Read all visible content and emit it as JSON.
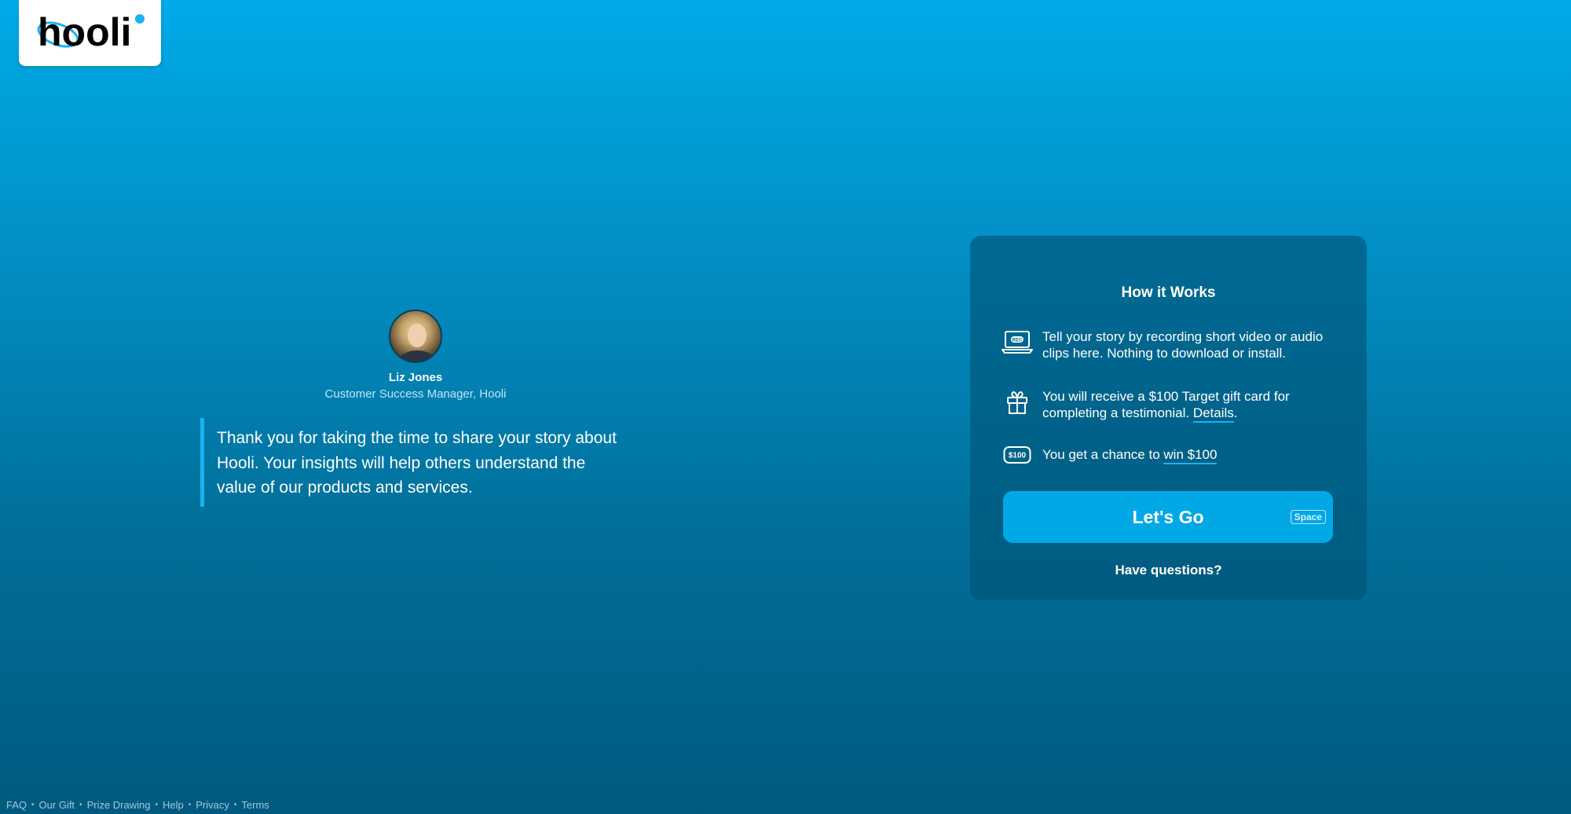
{
  "logo": {
    "text": "hooli"
  },
  "profile": {
    "name": "Liz Jones",
    "role": "Customer Success Manager, Hooli"
  },
  "quote": {
    "text": "Thank you for taking the time to share your story about Hooli. Your insights will help others understand the value of our products and services."
  },
  "how_it_works": {
    "title": "How it Works",
    "step1": {
      "icon": "laptop-rec-icon",
      "text": "Tell your story by recording short video or audio clips here. Nothing to download or install."
    },
    "step2": {
      "icon": "gift-icon",
      "text_before": "You will receive a $100 Target gift card for completing a testimonial. ",
      "link": "Details",
      "text_after": "."
    },
    "step3": {
      "icon": "prize-100-icon",
      "badge": "$100",
      "text_before": "You get a chance to ",
      "link": "win $100"
    },
    "rec_label": "REC",
    "button_label": "Let's Go",
    "button_shortcut": "Space",
    "questions_label": "Have questions?"
  },
  "footer": {
    "links": [
      "FAQ",
      "Our Gift",
      "Prize Drawing",
      "Help",
      "Privacy",
      "Terms"
    ],
    "separator": "•"
  },
  "colors": {
    "bg_top": "#00abe8",
    "bg_bottom": "#005a80",
    "card_bg": "#006a94",
    "accent": "#01a8e6",
    "link_underline": "#1ab3ef"
  }
}
